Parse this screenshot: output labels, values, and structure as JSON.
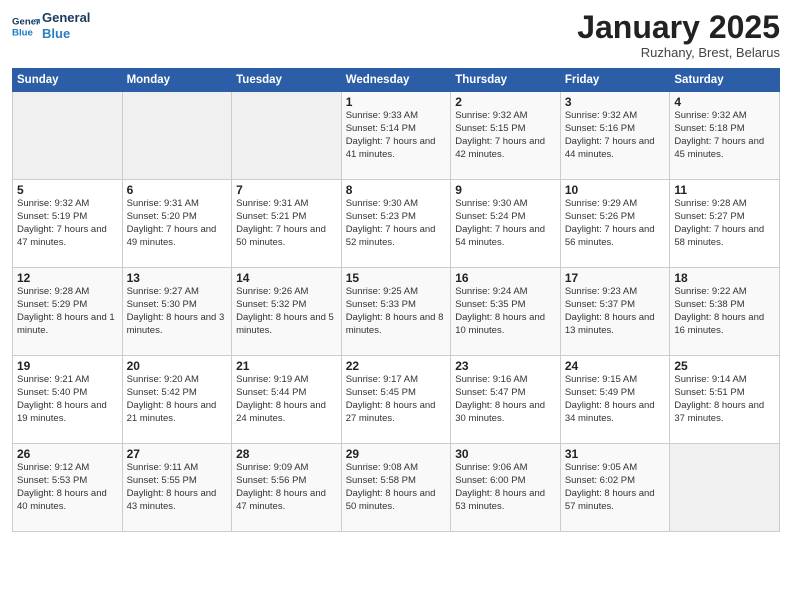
{
  "header": {
    "logo_line1": "General",
    "logo_line2": "Blue",
    "month": "January 2025",
    "location": "Ruzhany, Brest, Belarus"
  },
  "weekdays": [
    "Sunday",
    "Monday",
    "Tuesday",
    "Wednesday",
    "Thursday",
    "Friday",
    "Saturday"
  ],
  "weeks": [
    [
      {
        "day": "",
        "info": ""
      },
      {
        "day": "",
        "info": ""
      },
      {
        "day": "",
        "info": ""
      },
      {
        "day": "1",
        "info": "Sunrise: 9:33 AM\nSunset: 5:14 PM\nDaylight: 7 hours\nand 41 minutes."
      },
      {
        "day": "2",
        "info": "Sunrise: 9:32 AM\nSunset: 5:15 PM\nDaylight: 7 hours\nand 42 minutes."
      },
      {
        "day": "3",
        "info": "Sunrise: 9:32 AM\nSunset: 5:16 PM\nDaylight: 7 hours\nand 44 minutes."
      },
      {
        "day": "4",
        "info": "Sunrise: 9:32 AM\nSunset: 5:18 PM\nDaylight: 7 hours\nand 45 minutes."
      }
    ],
    [
      {
        "day": "5",
        "info": "Sunrise: 9:32 AM\nSunset: 5:19 PM\nDaylight: 7 hours\nand 47 minutes."
      },
      {
        "day": "6",
        "info": "Sunrise: 9:31 AM\nSunset: 5:20 PM\nDaylight: 7 hours\nand 49 minutes."
      },
      {
        "day": "7",
        "info": "Sunrise: 9:31 AM\nSunset: 5:21 PM\nDaylight: 7 hours\nand 50 minutes."
      },
      {
        "day": "8",
        "info": "Sunrise: 9:30 AM\nSunset: 5:23 PM\nDaylight: 7 hours\nand 52 minutes."
      },
      {
        "day": "9",
        "info": "Sunrise: 9:30 AM\nSunset: 5:24 PM\nDaylight: 7 hours\nand 54 minutes."
      },
      {
        "day": "10",
        "info": "Sunrise: 9:29 AM\nSunset: 5:26 PM\nDaylight: 7 hours\nand 56 minutes."
      },
      {
        "day": "11",
        "info": "Sunrise: 9:28 AM\nSunset: 5:27 PM\nDaylight: 7 hours\nand 58 minutes."
      }
    ],
    [
      {
        "day": "12",
        "info": "Sunrise: 9:28 AM\nSunset: 5:29 PM\nDaylight: 8 hours\nand 1 minute."
      },
      {
        "day": "13",
        "info": "Sunrise: 9:27 AM\nSunset: 5:30 PM\nDaylight: 8 hours\nand 3 minutes."
      },
      {
        "day": "14",
        "info": "Sunrise: 9:26 AM\nSunset: 5:32 PM\nDaylight: 8 hours\nand 5 minutes."
      },
      {
        "day": "15",
        "info": "Sunrise: 9:25 AM\nSunset: 5:33 PM\nDaylight: 8 hours\nand 8 minutes."
      },
      {
        "day": "16",
        "info": "Sunrise: 9:24 AM\nSunset: 5:35 PM\nDaylight: 8 hours\nand 10 minutes."
      },
      {
        "day": "17",
        "info": "Sunrise: 9:23 AM\nSunset: 5:37 PM\nDaylight: 8 hours\nand 13 minutes."
      },
      {
        "day": "18",
        "info": "Sunrise: 9:22 AM\nSunset: 5:38 PM\nDaylight: 8 hours\nand 16 minutes."
      }
    ],
    [
      {
        "day": "19",
        "info": "Sunrise: 9:21 AM\nSunset: 5:40 PM\nDaylight: 8 hours\nand 19 minutes."
      },
      {
        "day": "20",
        "info": "Sunrise: 9:20 AM\nSunset: 5:42 PM\nDaylight: 8 hours\nand 21 minutes."
      },
      {
        "day": "21",
        "info": "Sunrise: 9:19 AM\nSunset: 5:44 PM\nDaylight: 8 hours\nand 24 minutes."
      },
      {
        "day": "22",
        "info": "Sunrise: 9:17 AM\nSunset: 5:45 PM\nDaylight: 8 hours\nand 27 minutes."
      },
      {
        "day": "23",
        "info": "Sunrise: 9:16 AM\nSunset: 5:47 PM\nDaylight: 8 hours\nand 30 minutes."
      },
      {
        "day": "24",
        "info": "Sunrise: 9:15 AM\nSunset: 5:49 PM\nDaylight: 8 hours\nand 34 minutes."
      },
      {
        "day": "25",
        "info": "Sunrise: 9:14 AM\nSunset: 5:51 PM\nDaylight: 8 hours\nand 37 minutes."
      }
    ],
    [
      {
        "day": "26",
        "info": "Sunrise: 9:12 AM\nSunset: 5:53 PM\nDaylight: 8 hours\nand 40 minutes."
      },
      {
        "day": "27",
        "info": "Sunrise: 9:11 AM\nSunset: 5:55 PM\nDaylight: 8 hours\nand 43 minutes."
      },
      {
        "day": "28",
        "info": "Sunrise: 9:09 AM\nSunset: 5:56 PM\nDaylight: 8 hours\nand 47 minutes."
      },
      {
        "day": "29",
        "info": "Sunrise: 9:08 AM\nSunset: 5:58 PM\nDaylight: 8 hours\nand 50 minutes."
      },
      {
        "day": "30",
        "info": "Sunrise: 9:06 AM\nSunset: 6:00 PM\nDaylight: 8 hours\nand 53 minutes."
      },
      {
        "day": "31",
        "info": "Sunrise: 9:05 AM\nSunset: 6:02 PM\nDaylight: 8 hours\nand 57 minutes."
      },
      {
        "day": "",
        "info": ""
      }
    ]
  ]
}
